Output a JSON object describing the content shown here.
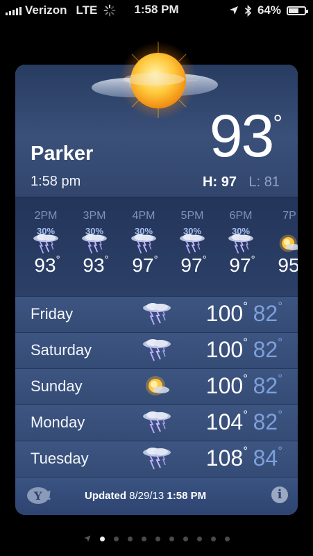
{
  "status": {
    "carrier": "Verizon",
    "network": "LTE",
    "time": "1:58 PM",
    "battery": "64%",
    "battery_level": 0.64
  },
  "weather": {
    "city": "Parker",
    "local_time": "1:58 pm",
    "current_temp": "93",
    "degree": "°",
    "high_label": "H: 97",
    "low_label": "L: 81"
  },
  "hourly": [
    {
      "time": "2PM",
      "chance": "30%",
      "temp": "93",
      "icon": "thunderstorm-icon"
    },
    {
      "time": "3PM",
      "chance": "30%",
      "temp": "93",
      "icon": "thunderstorm-icon"
    },
    {
      "time": "4PM",
      "chance": "30%",
      "temp": "97",
      "icon": "thunderstorm-icon"
    },
    {
      "time": "5PM",
      "chance": "30%",
      "temp": "97",
      "icon": "thunderstorm-icon"
    },
    {
      "time": "6PM",
      "chance": "30%",
      "temp": "97",
      "icon": "thunderstorm-icon"
    },
    {
      "time": "7P",
      "chance": "",
      "temp": "95",
      "icon": "sun-cloud-icon"
    }
  ],
  "daily": [
    {
      "day": "Friday",
      "high": "100",
      "low": "82",
      "icon": "thunderstorm-icon"
    },
    {
      "day": "Saturday",
      "high": "100",
      "low": "82",
      "icon": "thunderstorm-icon"
    },
    {
      "day": "Sunday",
      "high": "100",
      "low": "82",
      "icon": "partly-sunny-icon"
    },
    {
      "day": "Monday",
      "high": "104",
      "low": "82",
      "icon": "thunderstorm-icon"
    },
    {
      "day": "Tuesday",
      "high": "108",
      "low": "84",
      "icon": "thunderstorm-icon"
    }
  ],
  "footer": {
    "updated_label": "Updated",
    "updated_date": "8/29/13",
    "updated_time": "1:58 PM",
    "info": "i",
    "yahoo": "Y!"
  }
}
